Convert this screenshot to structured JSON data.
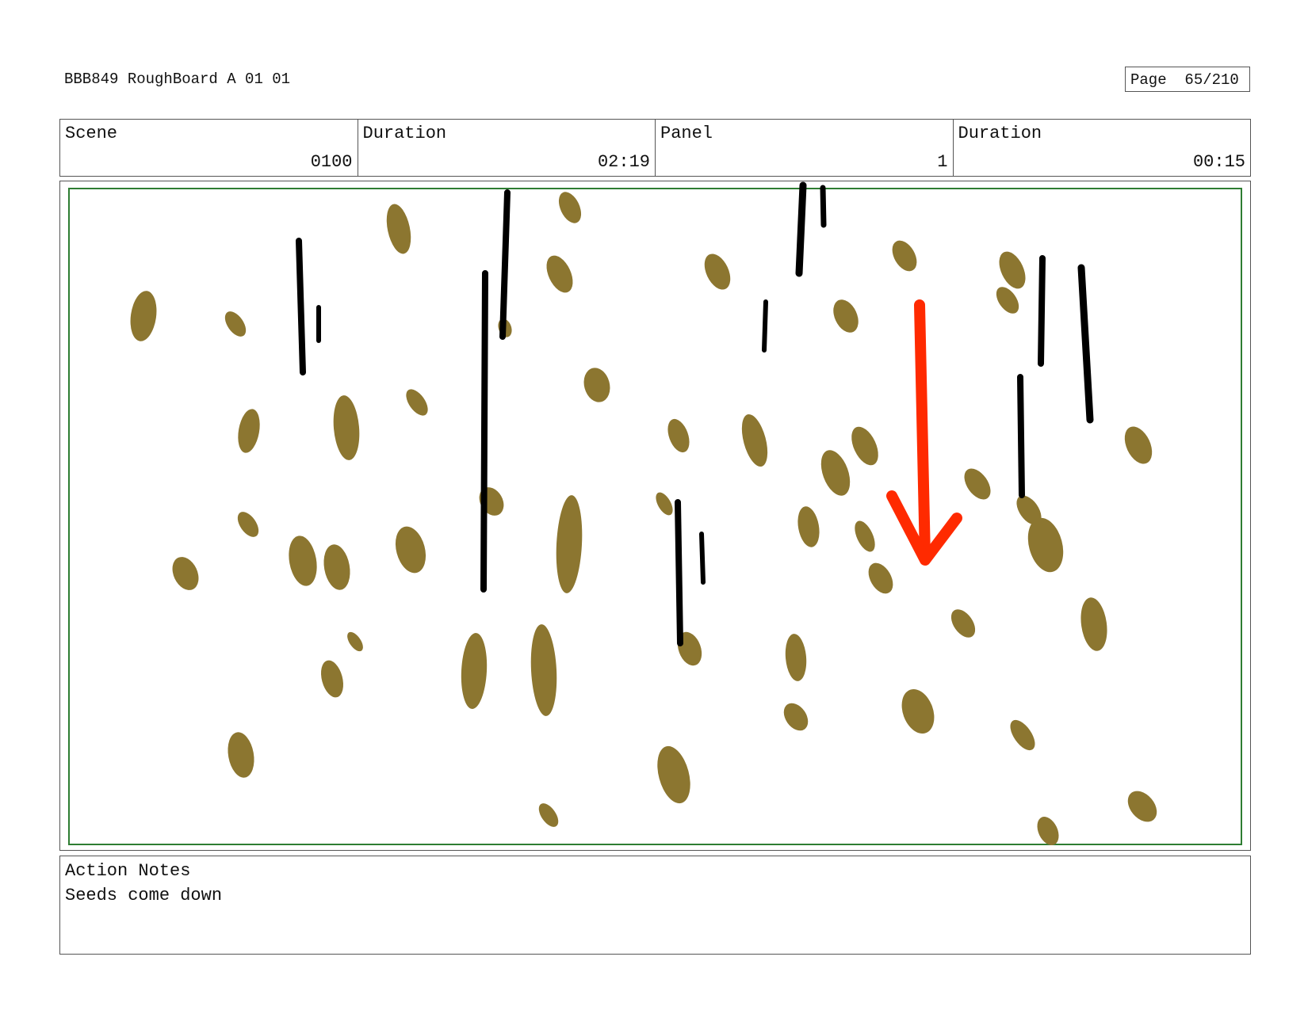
{
  "header": {
    "title": "BBB849 RoughBoard A 01 01",
    "page_label": "Page",
    "page_value": "65/210"
  },
  "info": {
    "scene_label": "Scene",
    "scene_value": "0100",
    "duration_label": "Duration",
    "duration_value": "02:19",
    "panel_label": "Panel",
    "panel_value": "1",
    "panel_duration_label": "Duration",
    "panel_duration_value": "00:15"
  },
  "notes": {
    "label": "Action Notes",
    "text": "Seeds come down"
  },
  "colors": {
    "seed": "#8c7630",
    "streak": "#000000",
    "arrow": "#ff2a00",
    "frame": "#2e7d32"
  }
}
